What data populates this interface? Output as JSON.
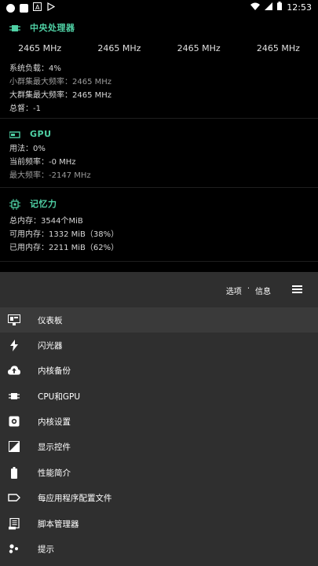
{
  "status_bar": {
    "time": "12:53"
  },
  "cpu": {
    "title": "中央处理器",
    "frequencies": [
      "2465 MHz",
      "2465 MHz",
      "2465 MHz",
      "2465 MHz"
    ],
    "load": "系统负载：4%",
    "little_max": "小群集最大频率：2465 MHz",
    "big_max": "大群集最大频率：2465 MHz",
    "total": "总督：-1"
  },
  "gpu": {
    "title": "GPU",
    "usage": "用法：0%",
    "current": "当前频率：-0 MHz",
    "max": "最大频率：-2147 MHz"
  },
  "memory": {
    "title": "记忆力",
    "total": "总内存：3544个MiB",
    "available": "可用内存：1332 MiB（38%）",
    "used": "已用内存：2211 MiB（62%）"
  },
  "sheet": {
    "tab_options": "选项",
    "tab_sep": "·",
    "tab_info": "信息",
    "items": [
      {
        "label": "仪表板",
        "icon": "dashboard-icon"
      },
      {
        "label": "闪光器",
        "icon": "flash-icon"
      },
      {
        "label": "内核备份",
        "icon": "cloud-upload-icon"
      },
      {
        "label": "CPU和GPU",
        "icon": "chip-icon"
      },
      {
        "label": "内核设置",
        "icon": "settings-icon"
      },
      {
        "label": "显示控件",
        "icon": "display-icon"
      },
      {
        "label": "性能简介",
        "icon": "battery-icon"
      },
      {
        "label": "每应用程序配置文件",
        "icon": "label-icon"
      },
      {
        "label": "脚本管理器",
        "icon": "script-icon"
      },
      {
        "label": "提示",
        "icon": "tips-icon"
      }
    ]
  },
  "colors": {
    "accent": "#4fd1a5",
    "sheet_bg": "#2f2f2f",
    "active_row": "#3a3a3a"
  }
}
